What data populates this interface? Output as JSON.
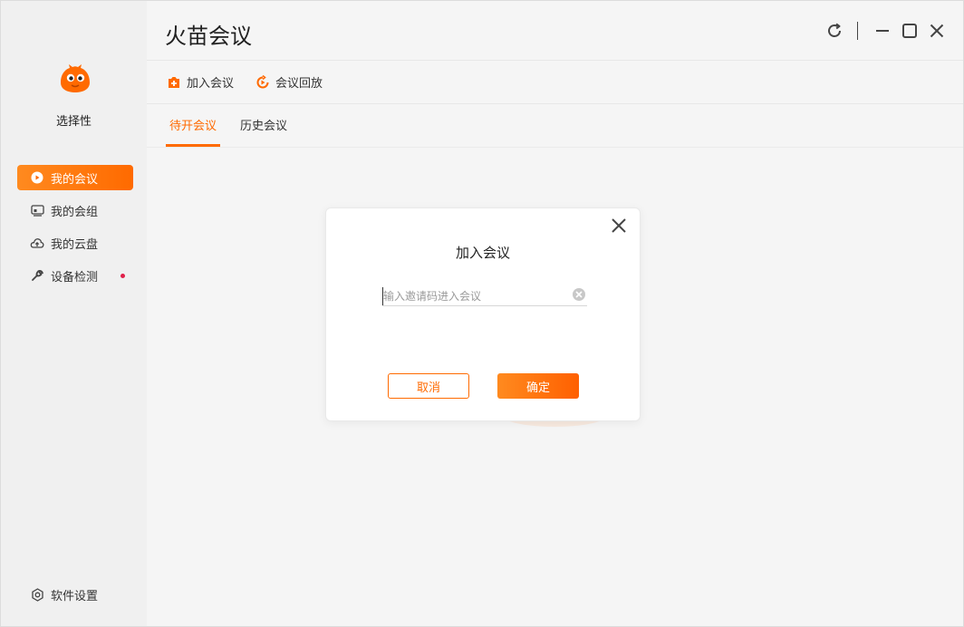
{
  "app": {
    "title": "火苗会议",
    "brand_color": "#ff6a00"
  },
  "sidebar": {
    "user": {
      "name": "选择性",
      "avatar_icon": "orange-flame-mascot-icon"
    },
    "items": [
      {
        "label": "我的会议",
        "icon": "meeting-video-icon",
        "active": true
      },
      {
        "label": "我的会组",
        "icon": "group-screen-icon",
        "active": false
      },
      {
        "label": "我的云盘",
        "icon": "cloud-upload-icon",
        "active": false
      },
      {
        "label": "设备检测",
        "icon": "wrench-icon",
        "active": false,
        "has_notification_dot": true
      }
    ],
    "settings": {
      "label": "软件设置",
      "icon": "settings-hexagon-icon"
    }
  },
  "window_controls": {
    "refresh_icon": "refresh-icon",
    "minimize_icon": "minimize-icon",
    "maximize_icon": "maximize-icon",
    "close_icon": "close-icon"
  },
  "toolbar": {
    "join_label": "加入会议",
    "join_icon": "add-meeting-icon",
    "replay_label": "会议回放",
    "replay_icon": "replay-icon"
  },
  "tabs": [
    {
      "label": "待开会议",
      "active": true
    },
    {
      "label": "历史会议",
      "active": false
    }
  ],
  "dialog": {
    "title": "加入会议",
    "input": {
      "value": "",
      "placeholder": "输入邀请码进入会议"
    },
    "cancel_label": "取消",
    "ok_label": "确定"
  }
}
